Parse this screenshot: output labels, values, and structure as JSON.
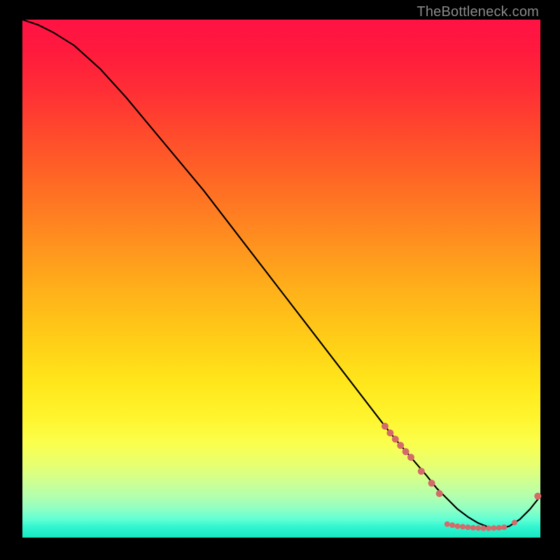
{
  "attribution": "TheBottleneck.com",
  "colors": {
    "background": "#000000",
    "curve": "#000000",
    "marker_fill": "#d46a6a",
    "marker_stroke": "#d46a6a"
  },
  "chart_data": {
    "type": "line",
    "title": "",
    "xlabel": "",
    "ylabel": "",
    "xlim": [
      0,
      100
    ],
    "ylim": [
      0,
      100
    ],
    "grid": false,
    "legend": false,
    "series": [
      {
        "name": "curve",
        "kind": "line",
        "x": [
          0,
          3,
          6,
          10,
          15,
          20,
          25,
          30,
          35,
          40,
          45,
          50,
          55,
          60,
          65,
          70,
          72,
          75,
          78,
          80,
          82,
          84,
          86,
          88,
          90,
          92,
          94,
          96,
          98,
          100
        ],
        "y": [
          100,
          99,
          97.5,
          95,
          90.5,
          85,
          79,
          73,
          67,
          60.5,
          54,
          47.5,
          41,
          34.5,
          28,
          21.5,
          19,
          15.5,
          12,
          9.5,
          7.5,
          5.5,
          4,
          2.8,
          2,
          1.7,
          2.2,
          3.5,
          5.5,
          8
        ]
      },
      {
        "name": "markers",
        "kind": "scatter",
        "points": [
          {
            "x": 70,
            "y": 21.5,
            "r": 5
          },
          {
            "x": 71,
            "y": 20.2,
            "r": 5
          },
          {
            "x": 72,
            "y": 19.0,
            "r": 5
          },
          {
            "x": 73,
            "y": 17.8,
            "r": 5
          },
          {
            "x": 74,
            "y": 16.6,
            "r": 5
          },
          {
            "x": 75,
            "y": 15.5,
            "r": 5
          },
          {
            "x": 77,
            "y": 12.8,
            "r": 5
          },
          {
            "x": 79,
            "y": 10.5,
            "r": 5
          },
          {
            "x": 80.5,
            "y": 8.5,
            "r": 5
          },
          {
            "x": 82,
            "y": 2.6,
            "r": 4
          },
          {
            "x": 83,
            "y": 2.4,
            "r": 4
          },
          {
            "x": 84,
            "y": 2.2,
            "r": 4
          },
          {
            "x": 85,
            "y": 2.1,
            "r": 4
          },
          {
            "x": 86,
            "y": 2.0,
            "r": 4
          },
          {
            "x": 87,
            "y": 1.9,
            "r": 4
          },
          {
            "x": 88,
            "y": 1.85,
            "r": 4
          },
          {
            "x": 89,
            "y": 1.8,
            "r": 4
          },
          {
            "x": 90,
            "y": 1.8,
            "r": 4
          },
          {
            "x": 91,
            "y": 1.85,
            "r": 4
          },
          {
            "x": 92,
            "y": 1.9,
            "r": 4
          },
          {
            "x": 93,
            "y": 2.0,
            "r": 4
          },
          {
            "x": 95,
            "y": 2.9,
            "r": 4
          },
          {
            "x": 99.5,
            "y": 8.0,
            "r": 5
          }
        ]
      }
    ]
  }
}
